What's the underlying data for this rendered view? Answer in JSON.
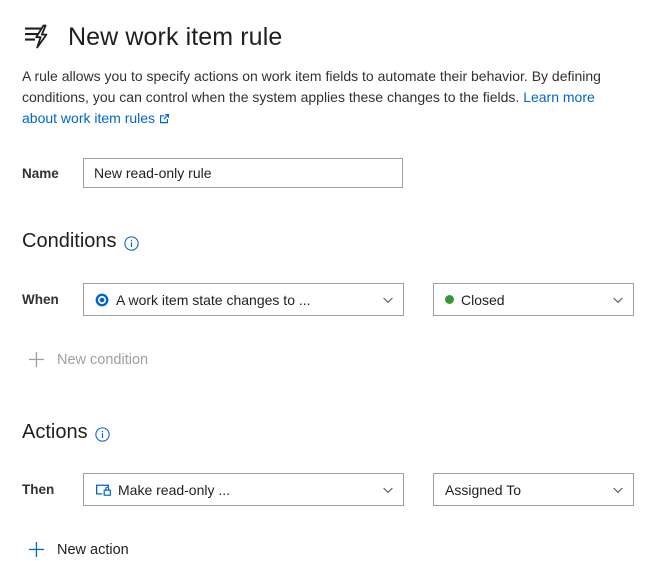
{
  "header": {
    "icon": "work-item-rule-lightning-icon",
    "title": "New work item rule"
  },
  "description": {
    "text_before_link": "A rule allows you to specify actions on work item fields to automate their behavior. By defining conditions, you can control when the system applies these changes to the fields. ",
    "link_text": "Learn more about work item rules",
    "link_icon": "external-link-icon"
  },
  "name_field": {
    "label": "Name",
    "value": "New read-only rule",
    "placeholder": "Name"
  },
  "conditions": {
    "heading": "Conditions",
    "info_icon": "info-icon",
    "row": {
      "label": "When",
      "condition_dropdown": {
        "icon": "state-circle-icon",
        "value": "A work item state changes to ...",
        "chevron": "chevron-down-icon"
      },
      "value_dropdown": {
        "icon": "green-status-dot-icon",
        "value": "Closed",
        "chevron": "chevron-down-icon"
      }
    },
    "add_link": {
      "icon": "plus-icon",
      "label": "New condition",
      "disabled": true
    }
  },
  "actions": {
    "heading": "Actions",
    "info_icon": "info-icon",
    "row": {
      "label": "Then",
      "action_dropdown": {
        "icon": "make-read-only-lock-icon",
        "value": "Make read-only ...",
        "chevron": "chevron-down-icon"
      },
      "field_dropdown": {
        "value": "Assigned To",
        "chevron": "chevron-down-icon"
      }
    },
    "add_link": {
      "icon": "plus-icon",
      "label": "New action",
      "disabled": false
    }
  },
  "colors": {
    "accent_blue": "#0066cc",
    "link_blue": "#0066cc",
    "status_green": "#339933",
    "border_gray": "#a19f9d",
    "text_dark": "#201f1e",
    "text_disabled": "#a19f9d"
  }
}
